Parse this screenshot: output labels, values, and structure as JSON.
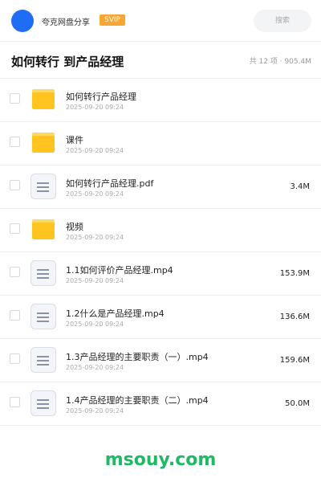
{
  "header": {
    "brand": "夸克网盘分享",
    "badge": "SVIP",
    "search_placeholder": "搜索"
  },
  "folder": {
    "title": "如何转行 到产品经理",
    "meta": "共 12 项 · 905.4M"
  },
  "files": [
    {
      "name": "如何转行产品经理",
      "date": "2025-09-20 09:24",
      "size": "",
      "type": "folder",
      "icon": "folder-icon"
    },
    {
      "name": "课件",
      "date": "2025-09-20 09:24",
      "size": "",
      "type": "folder",
      "icon": "folder-icon"
    },
    {
      "name": "如何转行产品经理.pdf",
      "date": "2025-09-20 09:24",
      "size": "3.4M",
      "type": "file",
      "icon": "document-icon"
    },
    {
      "name": "视频",
      "date": "2025-09-20 09:24",
      "size": "",
      "type": "folder",
      "icon": "folder-icon"
    },
    {
      "name": "1.1如何评价产品经理.mp4",
      "date": "2025-09-20 09:24",
      "size": "153.9M",
      "type": "file",
      "icon": "document-icon"
    },
    {
      "name": "1.2什么是产品经理.mp4",
      "date": "2025-09-20 09:24",
      "size": "136.6M",
      "type": "file",
      "icon": "document-icon"
    },
    {
      "name": "1.3产品经理的主要职责（一）.mp4",
      "date": "2025-09-20 09:24",
      "size": "159.6M",
      "type": "file",
      "icon": "document-icon"
    },
    {
      "name": "1.4产品经理的主要职责（二）.mp4",
      "date": "2025-09-20 09:24",
      "size": "50.0M",
      "type": "file",
      "icon": "document-icon"
    }
  ],
  "watermark": "msouy.com",
  "colors": {
    "avatar": "#1f6cf5",
    "badge": "#f7a533",
    "folder": "#ffc41f",
    "folder_tab": "#ffd85c",
    "watermark": "#1fb864"
  }
}
